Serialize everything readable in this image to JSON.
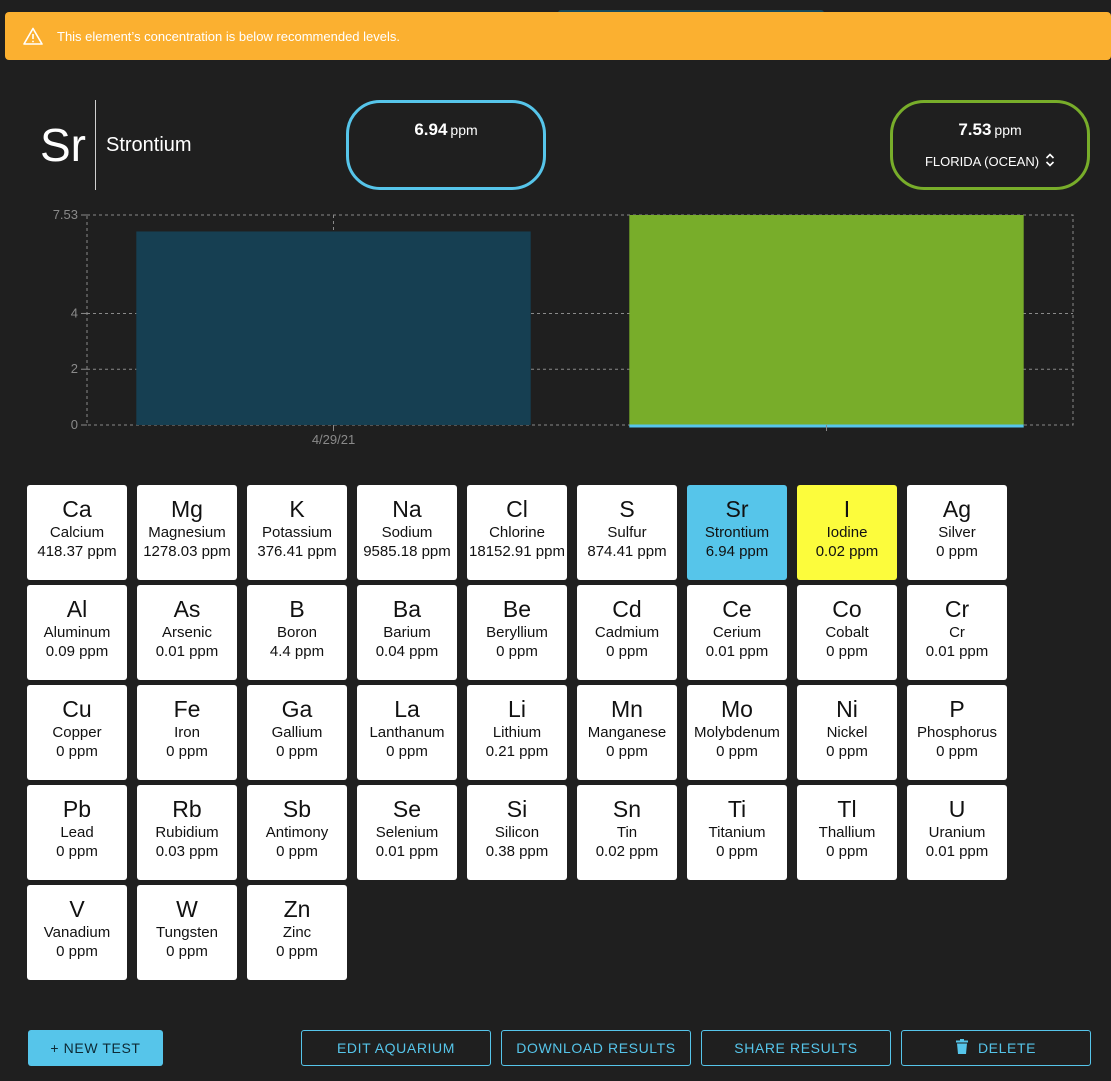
{
  "alert": {
    "message": "This element’s concentration is below recommended levels."
  },
  "element": {
    "symbol": "Sr",
    "name": "Strontium"
  },
  "current": {
    "value": "6.94",
    "unit": "ppm"
  },
  "target": {
    "value": "7.53",
    "unit": "ppm",
    "region": "FLORIDA (OCEAN)"
  },
  "colors": {
    "accent": "#56c5ea",
    "target": "#78ad2a",
    "bar_current": "#163f52",
    "alert": "#fbb030",
    "highlight": "#fcfc3c"
  },
  "chart_data": {
    "type": "bar",
    "categories": [
      "4/29/21",
      ""
    ],
    "values": [
      6.94,
      7.53
    ],
    "y_ticks": [
      "0",
      "2",
      "4",
      "7.53"
    ],
    "ylim": [
      0,
      7.53
    ],
    "grid": true
  },
  "elements": [
    {
      "sym": "Ca",
      "name": "Calcium",
      "val": "418.37 ppm"
    },
    {
      "sym": "Mg",
      "name": "Magnesium",
      "val": "1278.03 ppm"
    },
    {
      "sym": "K",
      "name": "Potassium",
      "val": "376.41 ppm"
    },
    {
      "sym": "Na",
      "name": "Sodium",
      "val": "9585.18 ppm"
    },
    {
      "sym": "Cl",
      "name": "Chlorine",
      "val": "18152.91 ppm"
    },
    {
      "sym": "S",
      "name": "Sulfur",
      "val": "874.41 ppm"
    },
    {
      "sym": "Sr",
      "name": "Strontium",
      "val": "6.94 ppm",
      "state": "active-blue"
    },
    {
      "sym": "I",
      "name": "Iodine",
      "val": "0.02 ppm",
      "state": "active-yellow"
    },
    {
      "sym": "Ag",
      "name": "Silver",
      "val": "0 ppm"
    },
    {
      "sym": "Al",
      "name": "Aluminum",
      "val": "0.09 ppm"
    },
    {
      "sym": "As",
      "name": "Arsenic",
      "val": "0.01 ppm"
    },
    {
      "sym": "B",
      "name": "Boron",
      "val": "4.4 ppm"
    },
    {
      "sym": "Ba",
      "name": "Barium",
      "val": "0.04 ppm"
    },
    {
      "sym": "Be",
      "name": "Beryllium",
      "val": "0 ppm"
    },
    {
      "sym": "Cd",
      "name": "Cadmium",
      "val": "0 ppm"
    },
    {
      "sym": "Ce",
      "name": "Cerium",
      "val": "0.01 ppm"
    },
    {
      "sym": "Co",
      "name": "Cobalt",
      "val": "0 ppm"
    },
    {
      "sym": "Cr",
      "name": "Cr",
      "val": "0.01 ppm"
    },
    {
      "sym": "Cu",
      "name": "Copper",
      "val": "0 ppm"
    },
    {
      "sym": "Fe",
      "name": "Iron",
      "val": "0 ppm"
    },
    {
      "sym": "Ga",
      "name": "Gallium",
      "val": "0 ppm"
    },
    {
      "sym": "La",
      "name": "Lanthanum",
      "val": "0 ppm"
    },
    {
      "sym": "Li",
      "name": "Lithium",
      "val": "0.21 ppm"
    },
    {
      "sym": "Mn",
      "name": "Manganese",
      "val": "0 ppm"
    },
    {
      "sym": "Mo",
      "name": "Molybdenum",
      "val": "0 ppm"
    },
    {
      "sym": "Ni",
      "name": "Nickel",
      "val": "0 ppm"
    },
    {
      "sym": "P",
      "name": "Phosphorus",
      "val": "0 ppm"
    },
    {
      "sym": "Pb",
      "name": "Lead",
      "val": "0 ppm"
    },
    {
      "sym": "Rb",
      "name": "Rubidium",
      "val": "0.03 ppm"
    },
    {
      "sym": "Sb",
      "name": "Antimony",
      "val": "0 ppm"
    },
    {
      "sym": "Se",
      "name": "Selenium",
      "val": "0.01 ppm"
    },
    {
      "sym": "Si",
      "name": "Silicon",
      "val": "0.38 ppm"
    },
    {
      "sym": "Sn",
      "name": "Tin",
      "val": "0.02 ppm"
    },
    {
      "sym": "Ti",
      "name": "Titanium",
      "val": "0 ppm"
    },
    {
      "sym": "Tl",
      "name": "Thallium",
      "val": "0 ppm"
    },
    {
      "sym": "U",
      "name": "Uranium",
      "val": "0.01 ppm"
    },
    {
      "sym": "V",
      "name": "Vanadium",
      "val": "0 ppm"
    },
    {
      "sym": "W",
      "name": "Tungsten",
      "val": "0 ppm"
    },
    {
      "sym": "Zn",
      "name": "Zinc",
      "val": "0 ppm"
    }
  ],
  "actions": {
    "new_test": "+ NEW TEST",
    "edit": "EDIT AQUARIUM",
    "download": "DOWNLOAD RESULTS",
    "share": "SHARE RESULTS",
    "delete": "DELETE"
  }
}
